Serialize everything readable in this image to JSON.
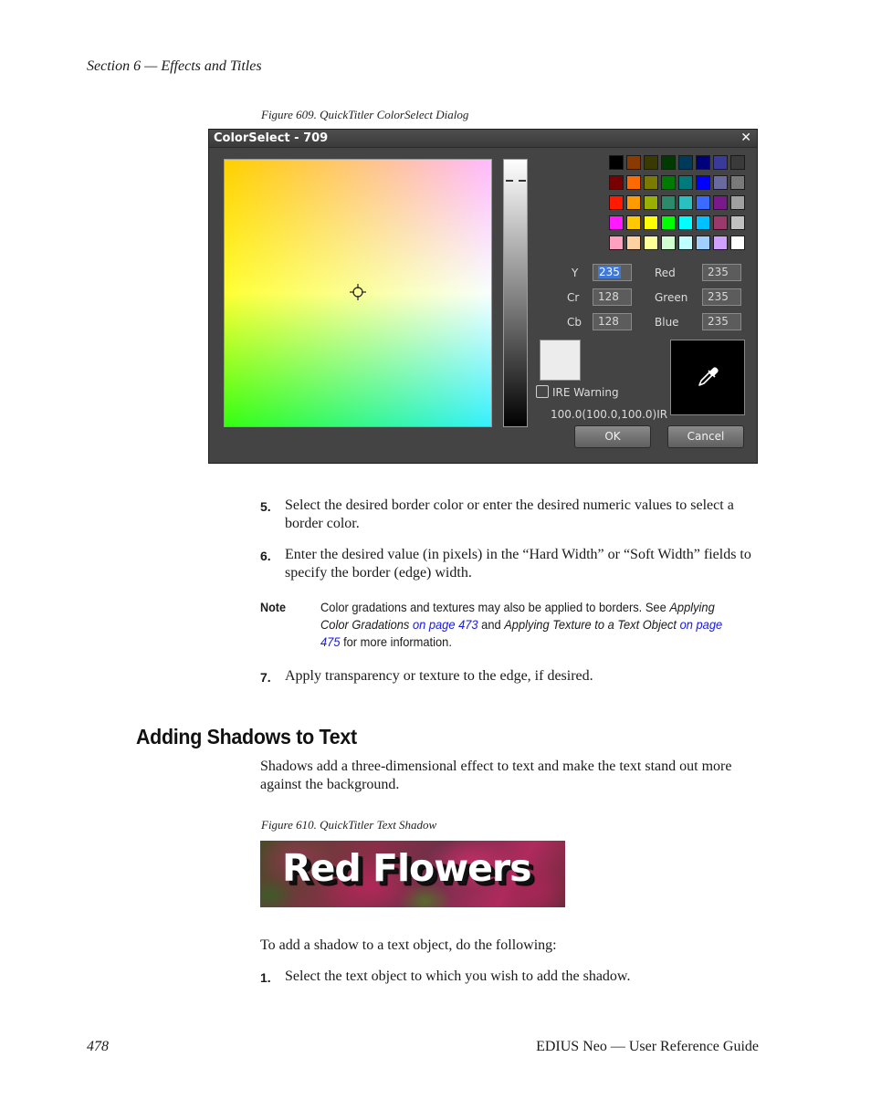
{
  "header": {
    "section": "Section 6 — Effects and Titles"
  },
  "figure609": {
    "caption": "Figure 609.  QuickTitler ColorSelect Dialog",
    "dialog": {
      "title": "ColorSelect - 709",
      "close": "✕",
      "fields": {
        "y_label": "Y",
        "y_value": "235",
        "cr_label": "Cr",
        "cr_value": "128",
        "cb_label": "Cb",
        "cb_value": "128",
        "red_label": "Red",
        "red_value": "235",
        "green_label": "Green",
        "green_value": "235",
        "blue_label": "Blue",
        "blue_value": "235"
      },
      "ire_warning": "IRE Warning",
      "ire_value": "100.0(100.0,100.0)IR",
      "ok": "OK",
      "cancel": "Cancel",
      "preview_color": "#ececec",
      "palette": [
        [
          "#000000",
          "#8a3a00",
          "#3a3a00",
          "#003a00",
          "#003a5a",
          "#00007a",
          "#3a3a9a",
          "#3a3a3a"
        ],
        [
          "#7a0000",
          "#ff6a00",
          "#7a7a00",
          "#007a00",
          "#007a7a",
          "#0000ff",
          "#6a6aa0",
          "#7a7a7a"
        ],
        [
          "#ff1a00",
          "#ff9a00",
          "#9ab000",
          "#2a8a6a",
          "#2ac0c0",
          "#3a6aff",
          "#7a1a8a",
          "#a0a0a0"
        ],
        [
          "#ff1aff",
          "#ffc800",
          "#ffff00",
          "#00ff00",
          "#00ffff",
          "#00c0ff",
          "#9a3a6a",
          "#c0c0c0"
        ],
        [
          "#ffa0c0",
          "#ffd0a0",
          "#ffff9a",
          "#d0ffd0",
          "#c0ffff",
          "#a0d0ff",
          "#d0a0ff",
          "#ffffff"
        ]
      ]
    }
  },
  "steps_a": [
    {
      "num": "5.",
      "text": "Select the desired border color or enter the desired numeric values to select a border color."
    },
    {
      "num": "6.",
      "text": "Enter the desired value (in pixels) in the “Hard Width” or “Soft Width” fields to specify the border (edge) width."
    }
  ],
  "note": {
    "label": "Note",
    "t1": "Color gradations and textures may also be applied to borders. See ",
    "ref1": "Applying Color Gradations",
    "link1": "on page 473",
    "t2": " and ",
    "ref2": "Applying Texture to a Text Object",
    "link2": "on page 475",
    "t3": " for more information."
  },
  "step7": {
    "num": "7.",
    "text": "Apply transparency or texture to the edge, if desired."
  },
  "section_heading": "Adding Shadows to Text",
  "intro": "Shadows add a three-dimensional effect to text and make the text stand out more against the background.",
  "figure610": {
    "caption": "Figure 610.  QuickTitler Text Shadow",
    "image_text": "Red Flowers"
  },
  "lead_in": "To add a shadow to a text object, do the following:",
  "step1": {
    "num": "1.",
    "text": "Select the text object to which you wish to add the shadow."
  },
  "footer": {
    "page": "478",
    "title": "EDIUS Neo  —  User Reference Guide"
  }
}
